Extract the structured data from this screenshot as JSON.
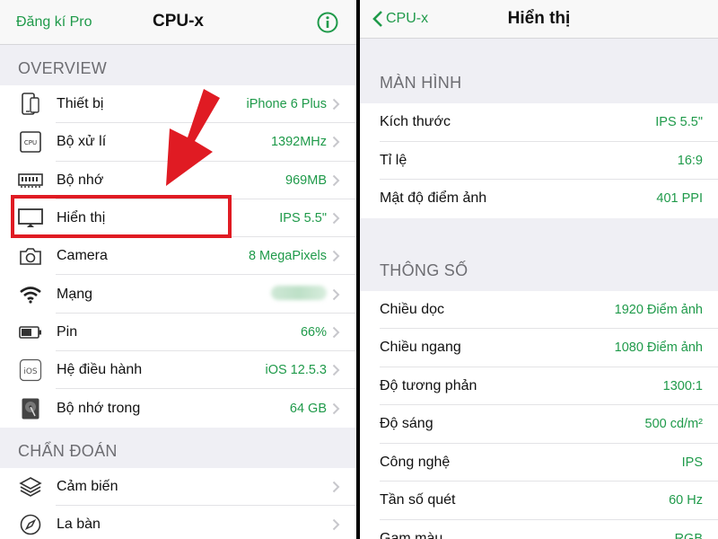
{
  "left": {
    "nav": {
      "left_link": "Đăng kí Pro",
      "title": "CPU-x",
      "info_icon": "info-icon"
    },
    "sections": [
      {
        "header": "OVERVIEW",
        "rows": [
          {
            "icon": "phone-icon",
            "label": "Thiết bị",
            "value": "iPhone 6 Plus"
          },
          {
            "icon": "cpu-icon",
            "label": "Bộ xử lí",
            "value": "1392MHz"
          },
          {
            "icon": "memory-icon",
            "label": "Bộ nhớ",
            "value": "969MB"
          },
          {
            "icon": "display-icon",
            "label": "Hiển thị",
            "value": "IPS 5.5\""
          },
          {
            "icon": "camera-icon",
            "label": "Camera",
            "value": "8 MegaPixels"
          },
          {
            "icon": "wifi-icon",
            "label": "Mạng",
            "value": ""
          },
          {
            "icon": "battery-icon",
            "label": "Pin",
            "value": "66%"
          },
          {
            "icon": "ios-icon",
            "label": "Hệ điều hành",
            "value": "iOS 12.5.3"
          },
          {
            "icon": "disk-icon",
            "label": "Bộ nhớ trong",
            "value": "64 GB"
          }
        ]
      },
      {
        "header": "CHẨN ĐOÁN",
        "rows": [
          {
            "icon": "layers-icon",
            "label": "Cảm biến",
            "value": ""
          },
          {
            "icon": "compass-icon",
            "label": "La bàn",
            "value": ""
          }
        ]
      }
    ]
  },
  "right": {
    "nav": {
      "back_label": "CPU-x",
      "title": "Hiển thị"
    },
    "sections": [
      {
        "header": "MÀN HÌNH",
        "rows": [
          {
            "label": "Kích thước",
            "value": "IPS 5.5\""
          },
          {
            "label": "Tỉ lệ",
            "value": "16:9"
          },
          {
            "label": "Mật độ điểm ảnh",
            "value": "401 PPI"
          }
        ]
      },
      {
        "header": "THÔNG SỐ",
        "rows": [
          {
            "label": "Chiều dọc",
            "value": "1920 Điểm ảnh"
          },
          {
            "label": "Chiều ngang",
            "value": "1080 Điểm ảnh"
          },
          {
            "label": "Độ tương phản",
            "value": "1300:1"
          },
          {
            "label": "Độ sáng",
            "value": "500 cd/m²"
          },
          {
            "label": "Công nghệ",
            "value": "IPS"
          },
          {
            "label": "Tần số quét",
            "value": "60 Hz"
          },
          {
            "label": "Gam màu",
            "value": "RGB"
          }
        ]
      }
    ]
  },
  "colors": {
    "accent": "#1f9a4a",
    "highlight": "#e01b23",
    "background": "#efeff4"
  }
}
